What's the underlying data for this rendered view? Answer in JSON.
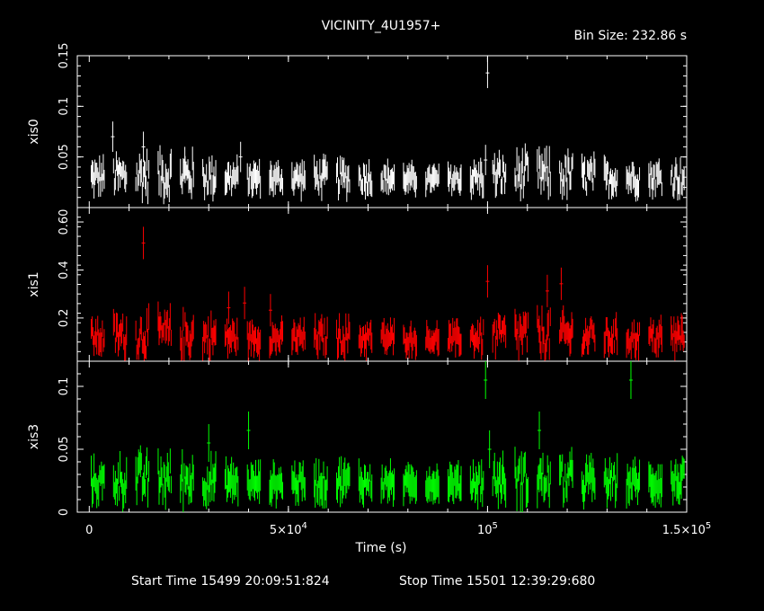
{
  "header": {
    "title": "VICINITY_4U1957+",
    "bin_size": "Bin Size: 232.86 s"
  },
  "footer": {
    "start_time": "Start Time 15499 20:09:51:824",
    "stop_time": "Stop Time 15501 12:39:29:680"
  },
  "colors": {
    "background": "#000000",
    "axes": "#ffffff",
    "xis0": "#ffffff",
    "xis1": "#ff0000",
    "xis3": "#00ff00"
  },
  "chart_data": [
    {
      "type": "scatter",
      "panel": "xis0",
      "ylabel": "xis0",
      "color": "#ffffff",
      "ylim": [
        0,
        0.15
      ],
      "yticks": [
        0.05,
        0.1,
        0.15
      ],
      "ytick_labels": [
        "0.05",
        "0.1",
        "0.15"
      ],
      "xlim": [
        -3000,
        150000
      ],
      "y_base": 0.025,
      "y_amp": 0.012,
      "y_err": 0.01,
      "peaks": [
        {
          "x": 5900,
          "y": 0.085
        },
        {
          "x": 13600,
          "y": 0.075
        },
        {
          "x": 100000,
          "y": 0.148
        },
        {
          "x": 99500,
          "y": 0.062
        },
        {
          "x": 38000,
          "y": 0.065
        },
        {
          "x": 24000,
          "y": 0.06
        }
      ]
    },
    {
      "type": "scatter",
      "panel": "xis1",
      "ylabel": "xis1",
      "color": "#ff0000",
      "ylim": [
        0.02,
        0.66
      ],
      "yticks": [
        0.2,
        0.4,
        0.6
      ],
      "ytick_labels": [
        "0.2",
        "0.4",
        "0.60"
      ],
      "xlim": [
        -3000,
        150000
      ],
      "y_base": 0.1,
      "y_amp": 0.05,
      "y_err": 0.045,
      "peaks": [
        {
          "x": 13600,
          "y": 0.58
        },
        {
          "x": 100000,
          "y": 0.42
        },
        {
          "x": 115000,
          "y": 0.38
        },
        {
          "x": 118500,
          "y": 0.41
        },
        {
          "x": 39000,
          "y": 0.33
        },
        {
          "x": 35000,
          "y": 0.31
        },
        {
          "x": 45500,
          "y": 0.3
        }
      ]
    },
    {
      "type": "scatter",
      "panel": "xis3",
      "ylabel": "xis3",
      "color": "#00ff00",
      "ylim": [
        0,
        0.12
      ],
      "yticks": [
        0,
        0.05,
        0.1
      ],
      "ytick_labels": [
        "0",
        "0.05",
        "0.1"
      ],
      "xlim": [
        -3000,
        150000
      ],
      "y_base": 0.02,
      "y_amp": 0.01,
      "y_err": 0.01,
      "peaks": [
        {
          "x": 99500,
          "y": 0.12
        },
        {
          "x": 136000,
          "y": 0.12
        },
        {
          "x": 40000,
          "y": 0.08
        },
        {
          "x": 30000,
          "y": 0.07
        },
        {
          "x": 100500,
          "y": 0.065
        },
        {
          "x": 113000,
          "y": 0.08
        }
      ]
    }
  ],
  "x_axis": {
    "xlabel": "Time (s)",
    "xticks": [
      0,
      50000,
      100000,
      150000
    ],
    "xtick_labels": [
      "0",
      "5×10",
      "10",
      "1.5×10"
    ],
    "xtick_exponents": [
      "",
      "4",
      "5",
      "5"
    ]
  }
}
